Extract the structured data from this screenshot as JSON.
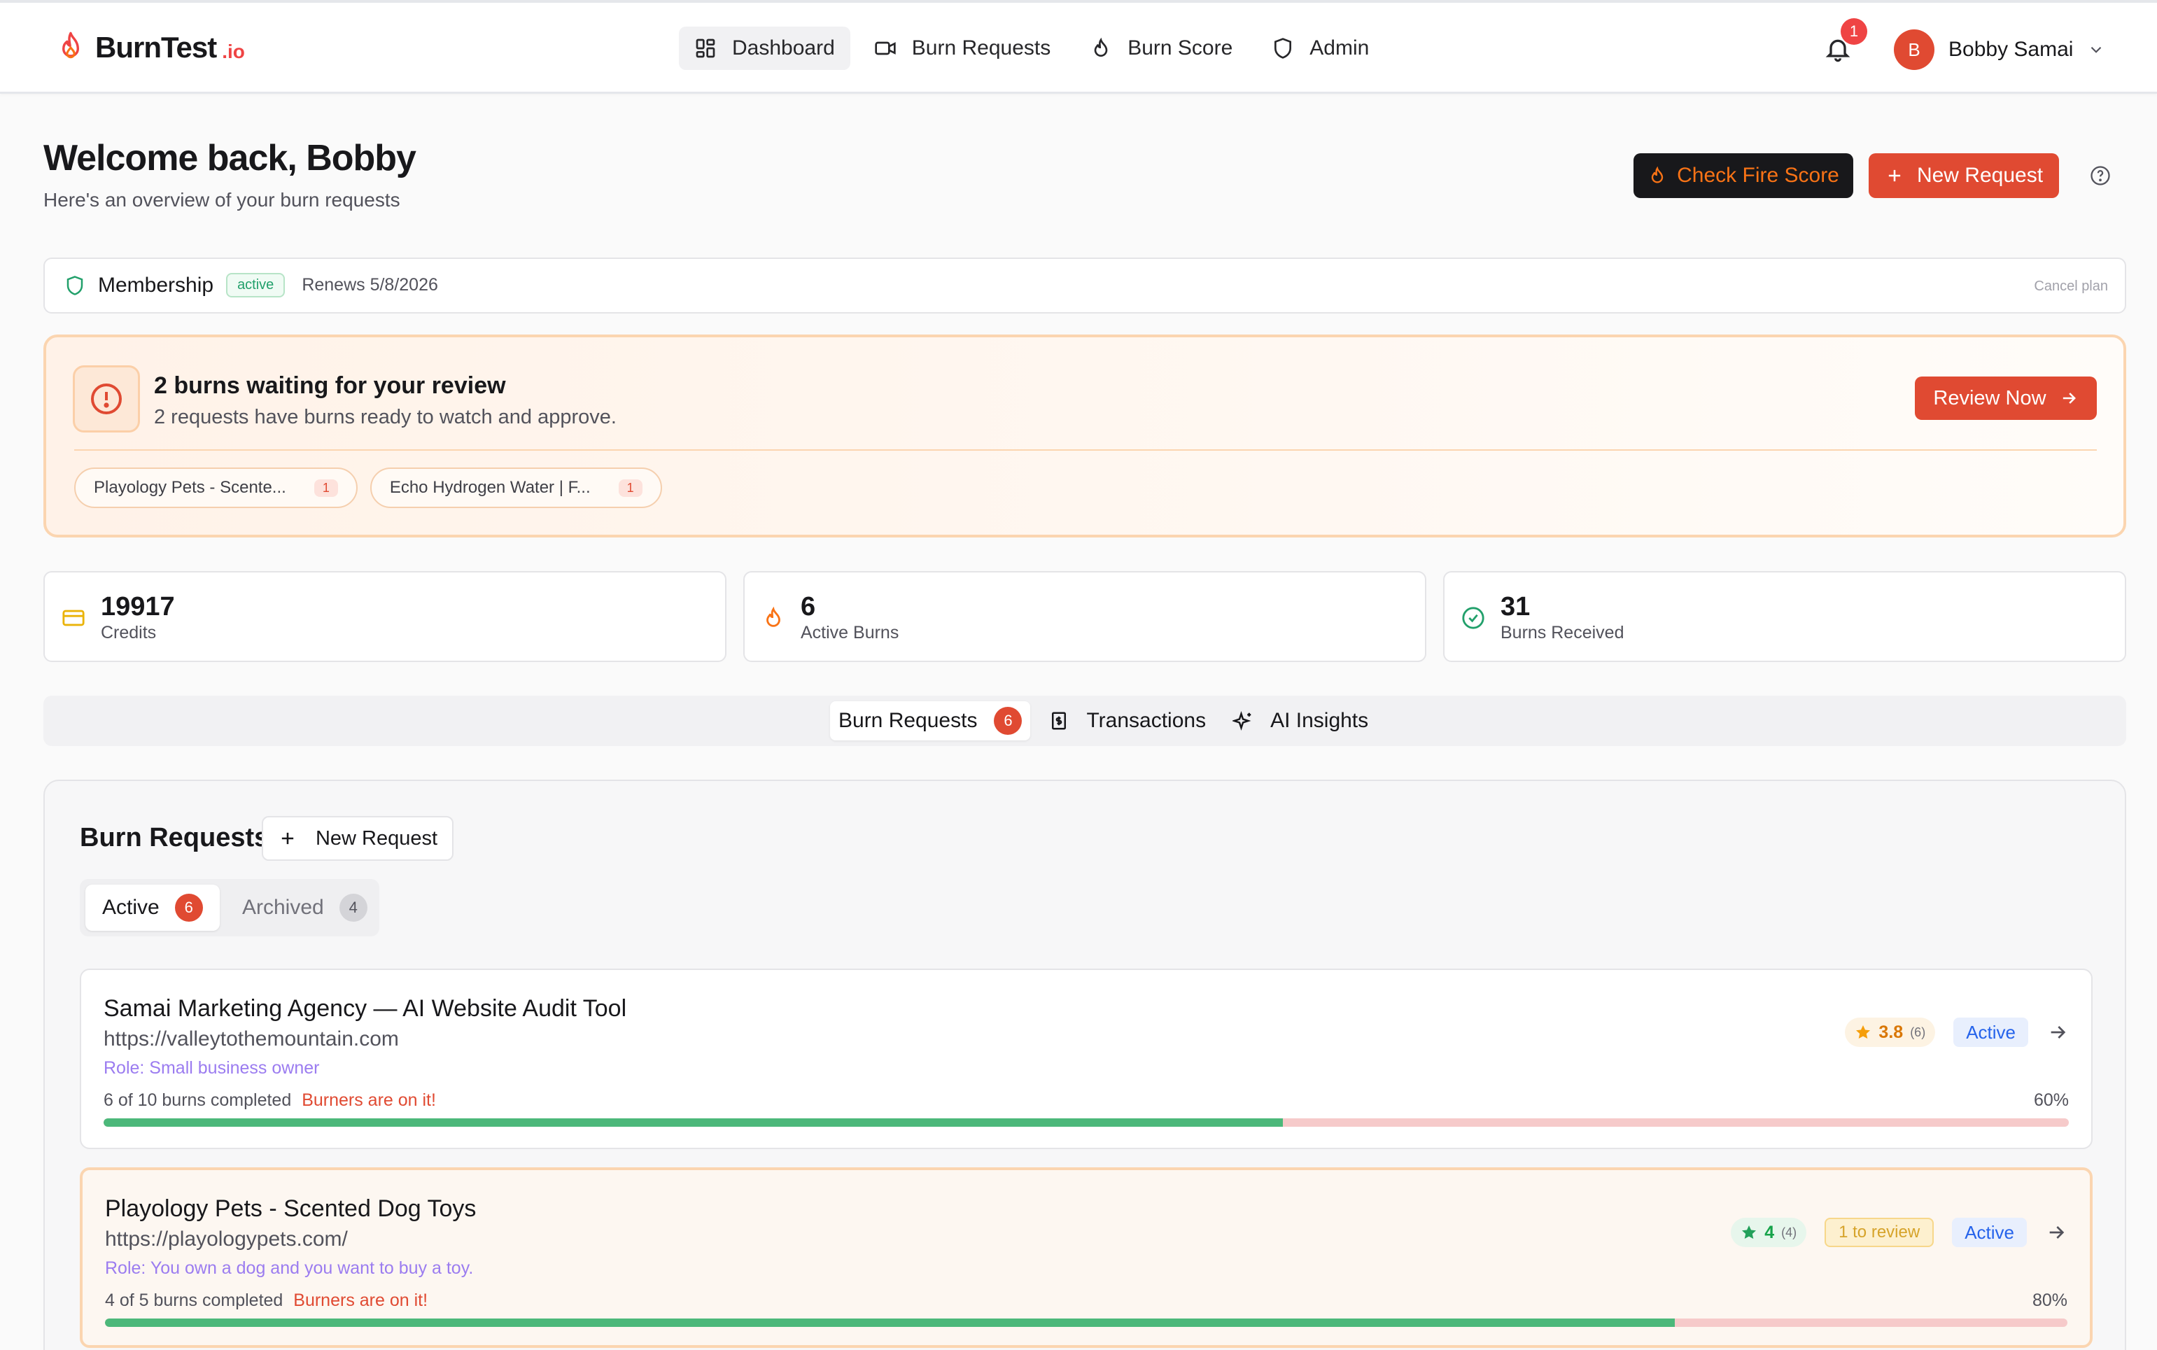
{
  "brand": {
    "name": "BurnTest",
    "suffix": ".io",
    "accent": "#e04a32"
  },
  "nav": {
    "items": [
      {
        "label": "Dashboard",
        "icon": "dashboard-icon",
        "active": true
      },
      {
        "label": "Burn Requests",
        "icon": "video-icon"
      },
      {
        "label": "Burn Score",
        "icon": "flame-icon"
      },
      {
        "label": "Admin",
        "icon": "shield-icon"
      }
    ],
    "notifications": "1",
    "user": {
      "initial": "B",
      "name": "Bobby Samai"
    }
  },
  "header": {
    "title": "Welcome back, Bobby",
    "subtitle": "Here's an overview of your burn requests",
    "check_fire_label": "Check Fire Score",
    "new_request_label": "New Request"
  },
  "membership": {
    "title": "Membership",
    "badge": "active",
    "renews": "Renews 5/8/2026",
    "cancel": "Cancel plan"
  },
  "review": {
    "title": "2 burns waiting for your review",
    "subtitle": "2 requests have burns ready to watch and approve.",
    "button": "Review Now",
    "chips": [
      {
        "label": "Playology Pets - Scente...",
        "count": "1"
      },
      {
        "label": "Echo Hydrogen Water | F...",
        "count": "1"
      }
    ]
  },
  "stats": [
    {
      "value": "19917",
      "label": "Credits",
      "icon": "credit-card-icon"
    },
    {
      "value": "6",
      "label": "Active Burns",
      "icon": "flame-icon"
    },
    {
      "value": "31",
      "label": "Burns Received",
      "icon": "check-circle-icon"
    }
  ],
  "tabs": {
    "burn_requests": "Burn Requests",
    "burn_requests_count": "6",
    "transactions": "Transactions",
    "ai_insights": "AI Insights"
  },
  "panel": {
    "title": "Burn Requests",
    "new_request": "New Request",
    "active_label": "Active",
    "active_count": "6",
    "archived_label": "Archived",
    "archived_count": "4"
  },
  "requests": [
    {
      "title": "Samai Marketing Agency — AI Website Audit Tool",
      "url": "https://valleytothemountain.com",
      "role": "Role: Small business owner",
      "progress_text": "6 of 10 burns completed",
      "burners": "Burners are on it!",
      "percent_text": "60%",
      "progress": 0.6,
      "rating": "3.8",
      "rating_count": "(6)",
      "status": "Active"
    },
    {
      "title": "Playology Pets - Scented Dog Toys",
      "url": "https://playologypets.com/",
      "role": "Role: You own a dog and you want to buy a toy.",
      "progress_text": "4 of 5 burns completed",
      "burners": "Burners are on it!",
      "percent_text": "80%",
      "progress": 0.8,
      "rating": "4",
      "rating_count": "(4)",
      "to_review": "1 to review",
      "status": "Active"
    }
  ]
}
